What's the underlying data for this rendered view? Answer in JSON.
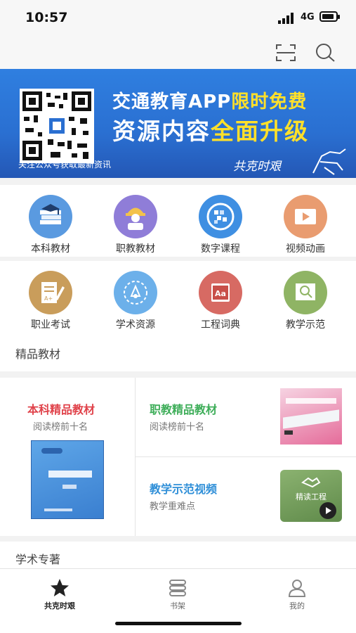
{
  "status": {
    "time": "10:57",
    "network": "4G"
  },
  "banner": {
    "line1_prefix": "交通教育APP",
    "line1_highlight": "限时免费",
    "line2_prefix": "资源内容",
    "line2_highlight": "全面升级",
    "qr_hint": "关注公众号获取最新资讯",
    "signature": "共克时艰"
  },
  "categories_row1": [
    {
      "label": "本科教材",
      "color": "#4a8fd8",
      "icon": "book-stack-icon"
    },
    {
      "label": "职教教材",
      "color": "#8b78d6",
      "icon": "engineer-icon"
    },
    {
      "label": "数字课程",
      "color": "#3b8fe0",
      "icon": "digital-course-icon"
    },
    {
      "label": "视频动画",
      "color": "#e89a6e",
      "icon": "video-play-icon"
    }
  ],
  "categories_row2": [
    {
      "label": "职业考试",
      "color": "#c79b5a",
      "icon": "exam-icon"
    },
    {
      "label": "学术资源",
      "color": "#5aa6e6",
      "icon": "academic-icon"
    },
    {
      "label": "工程词典",
      "color": "#d4665f",
      "icon": "dictionary-icon"
    },
    {
      "label": "教学示范",
      "color": "#8ab05e",
      "icon": "teaching-demo-icon"
    }
  ],
  "section_title": "精品教材",
  "featured": {
    "undergrad": {
      "title": "本科精品教材",
      "sub": "阅读榜前十名",
      "color": "#e0434b"
    },
    "vocational": {
      "title": "职教精品教材",
      "sub": "阅读榜前十名",
      "color": "#3fae5a"
    },
    "video": {
      "title": "教学示范视频",
      "sub": "教学重难点",
      "color": "#2f8fd8",
      "thumb_label": "精读工程"
    }
  },
  "section2_title": "学术专著",
  "tabs": [
    {
      "label": "共克时艰",
      "active": true
    },
    {
      "label": "书架",
      "active": false
    },
    {
      "label": "我的",
      "active": false
    }
  ]
}
